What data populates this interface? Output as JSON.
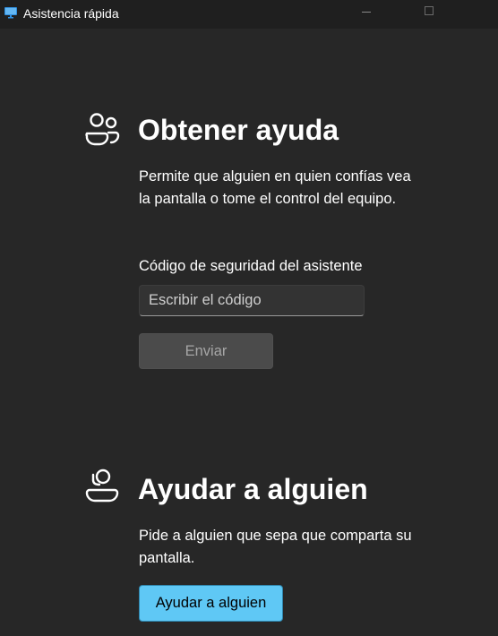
{
  "window": {
    "title": "Asistencia rápida",
    "app_icon": "monitor-icon",
    "controls": [
      "minimize-icon",
      "maximize-icon"
    ]
  },
  "get_help": {
    "icon": "people-icon",
    "title": "Obtener ayuda",
    "description": "Permite que alguien en quien confías vea la pantalla o tome el control del equipo.",
    "code_label": "Código de seguridad del asistente",
    "code_placeholder": "Escribir el código",
    "code_value": "",
    "submit_label": "Enviar",
    "submit_enabled": false
  },
  "give_help": {
    "icon": "person-headset-icon",
    "title": "Ayudar a alguien",
    "description": "Pide a alguien que sepa que comparta su pantalla.",
    "button_label": "Ayudar a alguien"
  },
  "colors": {
    "background": "#272727",
    "titlebar": "#1f1f1f",
    "accent": "#5fc8f5",
    "disabled_button": "#4b4b4b"
  }
}
